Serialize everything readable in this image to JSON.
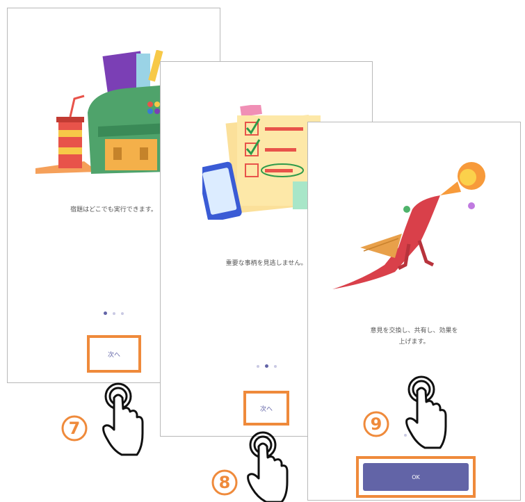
{
  "screens": [
    {
      "caption": "宿題はどこでも実行できます。",
      "button_label": "次へ",
      "step_number": "7",
      "active_dot": 0,
      "illustration": "backpack-illustration"
    },
    {
      "caption": "重要な事柄を見逃しません。",
      "button_label": "次へ",
      "step_number": "8",
      "active_dot": 1,
      "illustration": "checklist-illustration"
    },
    {
      "caption_line1": "意見を交換し、共有し、効果を",
      "caption_line2": "上げます。",
      "button_label": "OK",
      "step_number": "9",
      "active_dot": 2,
      "illustration": "dragon-illustration"
    }
  ],
  "colors": {
    "accent": "#6264a7",
    "highlight": "#ef8a3b",
    "dot_inactive": "#c9c9e3"
  },
  "icons": [
    "tap-hand-icon"
  ]
}
